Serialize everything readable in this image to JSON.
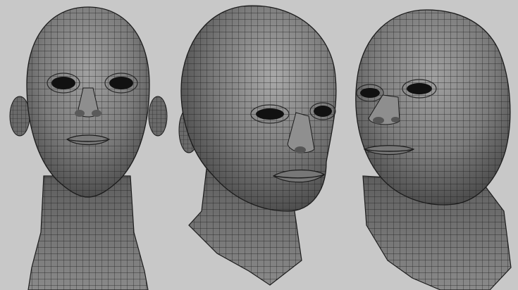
{
  "scene": {
    "background_color": "#c8c8c8",
    "mesh_fill": "#7b7b7b",
    "mesh_shadow": "#4a4a4a",
    "mesh_highlight": "#a4a4a4",
    "wire_color": "#1c1c1c",
    "views": [
      {
        "name": "front",
        "icon": "wireframe-head-front"
      },
      {
        "name": "three-quarter-right",
        "icon": "wireframe-head-three-quarter"
      },
      {
        "name": "three-quarter-up",
        "icon": "wireframe-head-low-angle"
      }
    ]
  }
}
